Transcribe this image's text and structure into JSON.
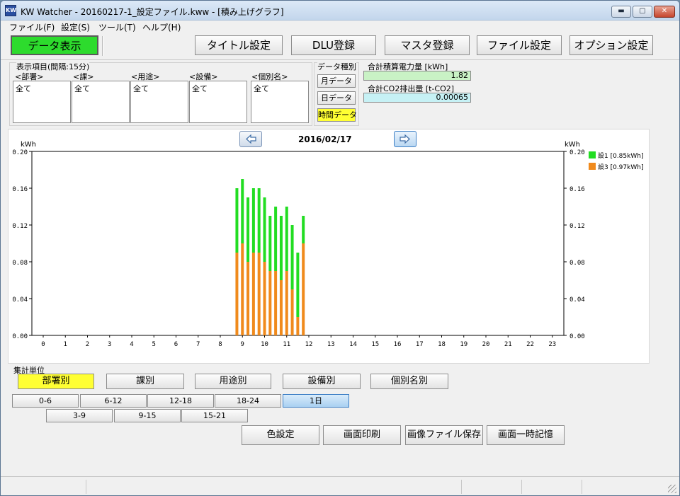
{
  "window": {
    "title": "KW Watcher - 20160217-1_設定ファイル.kww - [積み上げグラフ]",
    "icon_text": "KW",
    "buttons": {
      "minimize": "▬",
      "maximize": "▢",
      "close": "✕"
    }
  },
  "menu": [
    {
      "label": "ファイル(F)"
    },
    {
      "label": "設定(S)"
    },
    {
      "label": "ツール(T)"
    },
    {
      "label": "ヘルプ(H)"
    }
  ],
  "toolbar": {
    "data_display": "データ表示",
    "title_setting": "タイトル設定",
    "dlu_register": "DLU登録",
    "master_register": "マスタ登録",
    "file_setting": "ファイル設定",
    "option_setting": "オプション設定"
  },
  "display_items": {
    "caption": "表示項目(間隔:15分)",
    "columns": [
      {
        "header": "<部署>",
        "value": "全て"
      },
      {
        "header": "<課>",
        "value": "全て"
      },
      {
        "header": "<用途>",
        "value": "全て"
      },
      {
        "header": "<設備>",
        "value": "全て"
      },
      {
        "header": "<個別名>",
        "value": "全て"
      }
    ]
  },
  "data_type": {
    "caption": "データ種別",
    "monthly": "月データ",
    "daily": "日データ",
    "hourly": "時間データ",
    "selected": "hourly"
  },
  "summary": {
    "power_label": "合計積算電力量 [kWh]",
    "power_value": "1.82",
    "co2_label": "合計CO2排出量 [t-CO2]",
    "co2_value": "0.00065"
  },
  "chart_data": {
    "type": "bar",
    "stacked": true,
    "date": "2016/02/17",
    "ylabel_left": "kWh",
    "ylabel_right": "kWh",
    "ylim": [
      0,
      0.2
    ],
    "yticks": [
      "0.00",
      "0.04",
      "0.08",
      "0.12",
      "0.16",
      "0.20"
    ],
    "xticks": [
      "0",
      "1",
      "2",
      "3",
      "4",
      "5",
      "6",
      "7",
      "8",
      "9",
      "10",
      "11",
      "12",
      "13",
      "14",
      "15",
      "16",
      "17",
      "18",
      "19",
      "20",
      "21",
      "22",
      "23"
    ],
    "x_hours": [
      8.75,
      9.0,
      9.25,
      9.5,
      9.75,
      10.0,
      10.25,
      10.5,
      10.75,
      11.0,
      11.25,
      11.5,
      11.75
    ],
    "legend_position": "right",
    "series": [
      {
        "name": "設3 [0.97kWh]",
        "color": "#f08a1c",
        "values": [
          0.09,
          0.1,
          0.08,
          0.09,
          0.09,
          0.08,
          0.07,
          0.07,
          0.06,
          0.07,
          0.05,
          0.02,
          0.1
        ]
      },
      {
        "name": "設1 [0.85kWh]",
        "color": "#22dd22",
        "values": [
          0.07,
          0.07,
          0.07,
          0.07,
          0.07,
          0.07,
          0.06,
          0.07,
          0.07,
          0.07,
          0.07,
          0.07,
          0.03
        ]
      }
    ],
    "legend": [
      {
        "name": "設1 [0.85kWh]",
        "color": "#22dd22"
      },
      {
        "name": "設3 [0.97kWh]",
        "color": "#f08a1c"
      }
    ]
  },
  "aggregation": {
    "caption": "集計単位",
    "units": [
      {
        "label": "部署別"
      },
      {
        "label": "課別"
      },
      {
        "label": "用途別"
      },
      {
        "label": "設備別"
      },
      {
        "label": "個別名別"
      }
    ],
    "ranges_row1": [
      {
        "label": "0-6"
      },
      {
        "label": "6-12"
      },
      {
        "label": "12-18"
      },
      {
        "label": "18-24"
      },
      {
        "label": "1日"
      }
    ],
    "ranges_row2": [
      {
        "label": "3-9"
      },
      {
        "label": "9-15"
      },
      {
        "label": "15-21"
      }
    ]
  },
  "actions": {
    "color_setting": "色設定",
    "print_screen": "画面印刷",
    "save_image": "画像ファイル保存",
    "memorize_screen": "画面一時記憶"
  },
  "icons": {
    "prev": "arrow-left-icon",
    "next": "arrow-right-icon"
  }
}
